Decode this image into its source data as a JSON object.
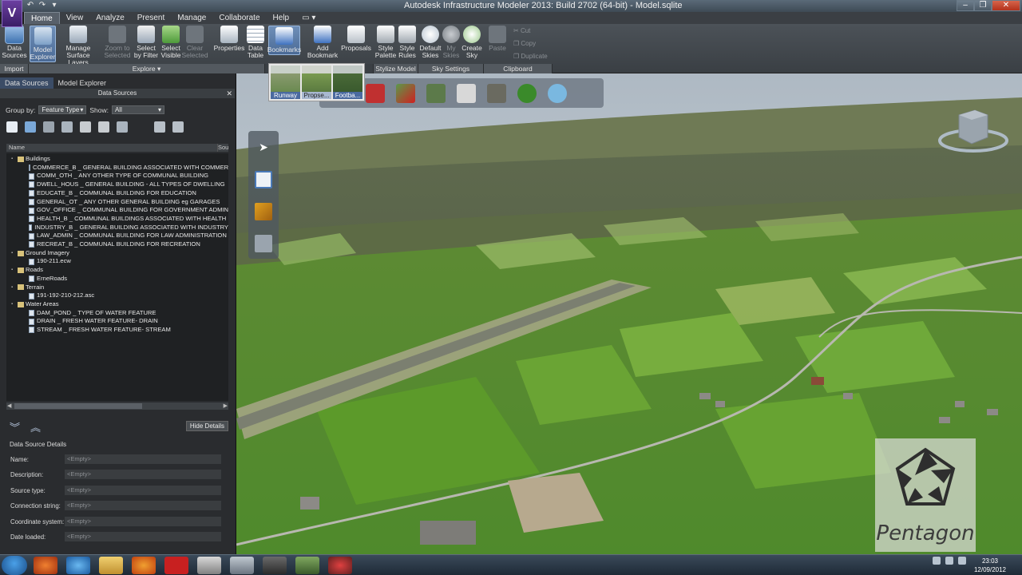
{
  "window": {
    "title": "Autodesk Infrastructure Modeler 2013: Build 2702 (64-bit) - Model.sqlite",
    "logo_letter": "V"
  },
  "menu_tabs": [
    "Home",
    "View",
    "Analyze",
    "Present",
    "Manage",
    "Collaborate",
    "Help"
  ],
  "ribbon": {
    "buttons": {
      "data_sources": "Data Sources",
      "model_explorer": "Model Explorer",
      "manage_surface_layers": "Manage Surface Layers",
      "zoom_to_selected": "Zoom to Selected",
      "select_by_filter": "Select by Filter",
      "select_visible": "Select Visible",
      "clear_selected": "Clear Selected",
      "properties": "Properties",
      "data_table": "Data Table",
      "bookmarks": "Bookmarks",
      "add_bookmark": "Add Bookmark",
      "proposals": "Proposals",
      "style_palette": "Style Palette",
      "style_rules": "Style Rules",
      "default_skies": "Default Skies",
      "my_skies": "My Skies",
      "create_sky": "Create Sky",
      "paste": "Paste",
      "cut": "Cut",
      "copy": "Copy",
      "duplicate": "Duplicate"
    },
    "panels": {
      "import": "Import",
      "explore": "Explore ▾",
      "stylize_model": "Stylize Model",
      "sky_settings": "Sky Settings",
      "clipboard": "Clipboard"
    }
  },
  "bookmarks": [
    {
      "label": "Runway"
    },
    {
      "label": "Propse..."
    },
    {
      "label": "Footba..."
    }
  ],
  "left_panel": {
    "tabs": [
      "Data Sources",
      "Model Explorer"
    ],
    "title": "Data Sources",
    "group_by_label": "Group by:",
    "group_by_value": "Feature Type",
    "show_label": "Show:",
    "show_value": "All",
    "col_name": "Name",
    "col_source": "Sou",
    "tree": [
      {
        "label": "Buildings",
        "level": 0
      },
      {
        "label": "COMMERCE_B _ GENERAL BUILDING ASSOCIATED WITH COMMERCE",
        "level": 1
      },
      {
        "label": "COMM_OTH _ ANY OTHER TYPE OF COMMUNAL BUILDING",
        "level": 1
      },
      {
        "label": "DWELL_HOUS _ GENERAL BUILDING - ALL TYPES OF DWELLING",
        "level": 1
      },
      {
        "label": "EDUCATE_B _ COMMUNAL BUILDING FOR EDUCATION",
        "level": 1
      },
      {
        "label": "GENERAL_OT _ ANY OTHER GENERAL BUILDING eg GARAGES",
        "level": 1
      },
      {
        "label": "GOV_OFFICE _ COMMUNAL BUILDING FOR GOVERNMENT ADMIN",
        "level": 1
      },
      {
        "label": "HEALTH_B _ COMMUNAL BUILDINGS ASSOCIATED WITH HEALTH",
        "level": 1
      },
      {
        "label": "INDUSTRY_B _ GENERAL BUILDING ASSOCIATED WITH INDUSTRY",
        "level": 1
      },
      {
        "label": "LAW_ADMIN _ COMMUNAL BUILDING FOR LAW ADMINISTRATION",
        "level": 1
      },
      {
        "label": "RECREAT_B _ COMMUNAL BUILDING FOR RECREATION",
        "level": 1
      },
      {
        "label": "Ground Imagery",
        "level": 0
      },
      {
        "label": "190-211.ecw",
        "level": 1
      },
      {
        "label": "Roads",
        "level": 0
      },
      {
        "label": "ErneRoads",
        "level": 1
      },
      {
        "label": "Terrain",
        "level": 0
      },
      {
        "label": "191-192-210-212.asc",
        "level": 1
      },
      {
        "label": "Water Areas",
        "level": 0
      },
      {
        "label": "DAM_POND _ TYPE OF WATER FEATURE",
        "level": 1
      },
      {
        "label": "DRAIN _ FRESH WATER FEATURE- DRAIN",
        "level": 1
      },
      {
        "label": "STREAM _ FRESH WATER FEATURE- STREAM",
        "level": 1
      }
    ],
    "hide_details": "Hide Details",
    "details_title": "Data Source Details",
    "details": [
      {
        "label": "Name:",
        "value": "<Empty>"
      },
      {
        "label": "Description:",
        "value": "<Empty>"
      },
      {
        "label": "Source type:",
        "value": "<Empty>"
      },
      {
        "label": "Connection string:",
        "value": "<Empty>"
      },
      {
        "label": "Coordinate system:",
        "value": "<Empty>"
      },
      {
        "label": "Date loaded:",
        "value": "<Empty>"
      }
    ]
  },
  "viewport": {
    "logo_text": "Pentagon"
  },
  "taskbar": {
    "time": "23:03",
    "date": "12/09/2012"
  },
  "colors": {
    "grass": "#6f9a3c",
    "accent": "#4a6aa0",
    "sky": "#c9d3dc"
  }
}
